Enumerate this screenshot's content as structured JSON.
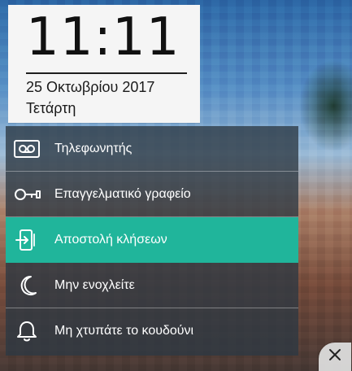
{
  "clock": {
    "time": "11:11",
    "date": "25 Οκτωβρίου 2017",
    "day": "Τετάρτη"
  },
  "menu": {
    "items": [
      {
        "label": "Τηλεφωνητής",
        "icon": "voicemail-icon"
      },
      {
        "label": "Επαγγελματικό γραφείο",
        "icon": "key-icon"
      },
      {
        "label": "Αποστολή κλήσεων",
        "icon": "call-forward-icon",
        "active": true
      },
      {
        "label": "Μην ενοχλείτε",
        "icon": "moon-icon"
      },
      {
        "label": "Μη χτυπάτε το κουδούνι",
        "icon": "bell-icon"
      }
    ]
  },
  "close": {
    "icon": "close-icon"
  },
  "colors": {
    "accent": "#20b59b",
    "menu_bg": "#2d3943",
    "clock_bg": "#f5f5f5"
  }
}
